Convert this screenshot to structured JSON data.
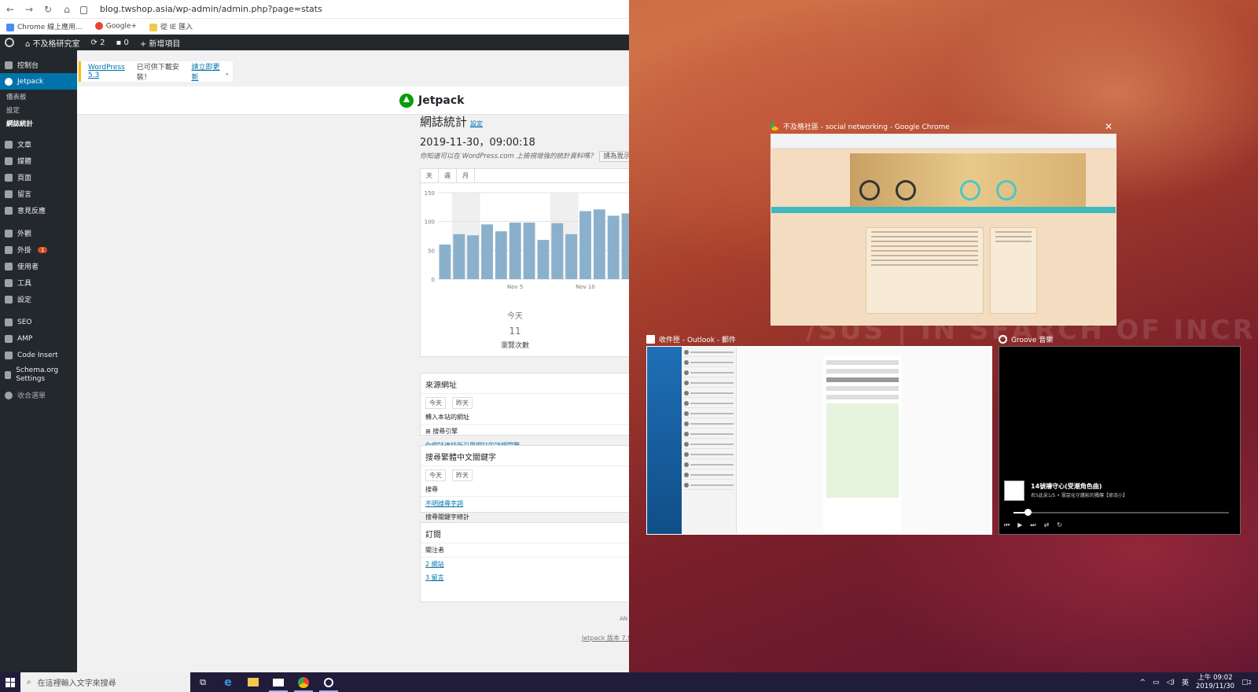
{
  "browser": {
    "url": "blog.twshop.asia/wp-admin/admin.php?page=stats",
    "bookmarks": [
      "Chrome 線上應用...",
      "Google+",
      "從 IE 匯入"
    ]
  },
  "adminbar": {
    "site_name": "不及格研究室",
    "updates": "2",
    "comments": "0",
    "new_item": "新增項目"
  },
  "sidebar": {
    "items": [
      {
        "label": "控制台"
      },
      {
        "label": "Jetpack"
      },
      {
        "label": "文章"
      },
      {
        "label": "媒體"
      },
      {
        "label": "頁面"
      },
      {
        "label": "留言"
      },
      {
        "label": "意見反應"
      },
      {
        "label": "外觀"
      },
      {
        "label": "外掛"
      },
      {
        "label": "使用者"
      },
      {
        "label": "工具"
      },
      {
        "label": "設定"
      },
      {
        "label": "SEO"
      },
      {
        "label": "AMP"
      },
      {
        "label": "Code Insert"
      },
      {
        "label": "Schema.org Settings"
      },
      {
        "label": "收合選單"
      }
    ],
    "jetpack_sub": [
      "儀表板",
      "設定",
      "網誌統計"
    ],
    "plugin_badge": "1"
  },
  "notice": {
    "link1": "WordPress 5.3",
    "text": " 已可供下載安裝！",
    "link2": "請立即更新",
    "end": "。"
  },
  "jetpack": {
    "brand": "Jetpack",
    "stats_title": "網誌統計",
    "settings_link": "設定",
    "date": "2019-11-30，09:00:18",
    "info": "你知道可以在 WordPress.com 上檢視增強的統計資料嗎？",
    "info_button": "請為我示範",
    "tabs": [
      "天",
      "週",
      "月"
    ],
    "summary_label": "今天",
    "summary_value": "11",
    "summary_caption": "瀏覽次數",
    "referrers_title": "來源網址",
    "referrers_tabs": [
      "今天",
      "昨天"
    ],
    "referrers_row": "轉入本站的網址",
    "referrers_search": "搜尋引擎",
    "referrers_link": "你網誌連結所引用網站的詳細閱覽",
    "search_title": "搜尋繁體中文關鍵字",
    "search_tabs": [
      "今天",
      "昨天"
    ],
    "search_row": "搜尋",
    "search_none": "不明搜尋字詞",
    "search_footer": "搜尋關鍵字總計",
    "sub_title": "訂閱",
    "sub_row": "關注者",
    "sub_link1": "2 網站",
    "sub_link2": "3 留言",
    "footer": "Jetpack 版本 7.9",
    "ann": "AN"
  },
  "chart_data": {
    "type": "bar",
    "categories": [
      "d1",
      "d2",
      "d3",
      "d4",
      "d5",
      "d6",
      "d7",
      "d8",
      "d9",
      "d10",
      "d11",
      "d12",
      "d13",
      "d14"
    ],
    "x_tick_labels": [
      {
        "index": 5,
        "label": "Nov 5"
      },
      {
        "index": 10,
        "label": "Nov 10"
      }
    ],
    "values": [
      60,
      78,
      76,
      95,
      83,
      98,
      98,
      68,
      97,
      78,
      118,
      121,
      110,
      114
    ],
    "ylim": [
      0,
      150
    ],
    "yticks": [
      0,
      50,
      100,
      150
    ],
    "highlighted_bands": [
      [
        1,
        2
      ],
      [
        8,
        9
      ]
    ],
    "bar_color": "#8bb0cb",
    "title": "",
    "xlabel": "",
    "ylabel": ""
  },
  "taskview": {
    "chrome_title": "不及格社區 - social networking - Google Chrome",
    "outlook_title": "收件匣 - Outlook - 郵件",
    "groove_title": "Groove 音樂",
    "groove_track": "14號禱守心(受潮角色曲)",
    "groove_sub": "名5此采1/5 • 罪惡化守護影的獨傳【邪流小】",
    "wallpaper_text": "/SUS  |  IN SEARCH OF INCREDIBLE"
  },
  "taskbar": {
    "search_placeholder": "在這裡輸入文字來搜尋",
    "ime": "英",
    "time": "上午 09:02",
    "date": "2019/11/30",
    "notif": "2"
  },
  "colors": {
    "wp_dark": "#23282d",
    "wp_blue": "#0073aa",
    "jetpack_green": "#069e08",
    "taskbar": "#211c3a"
  }
}
